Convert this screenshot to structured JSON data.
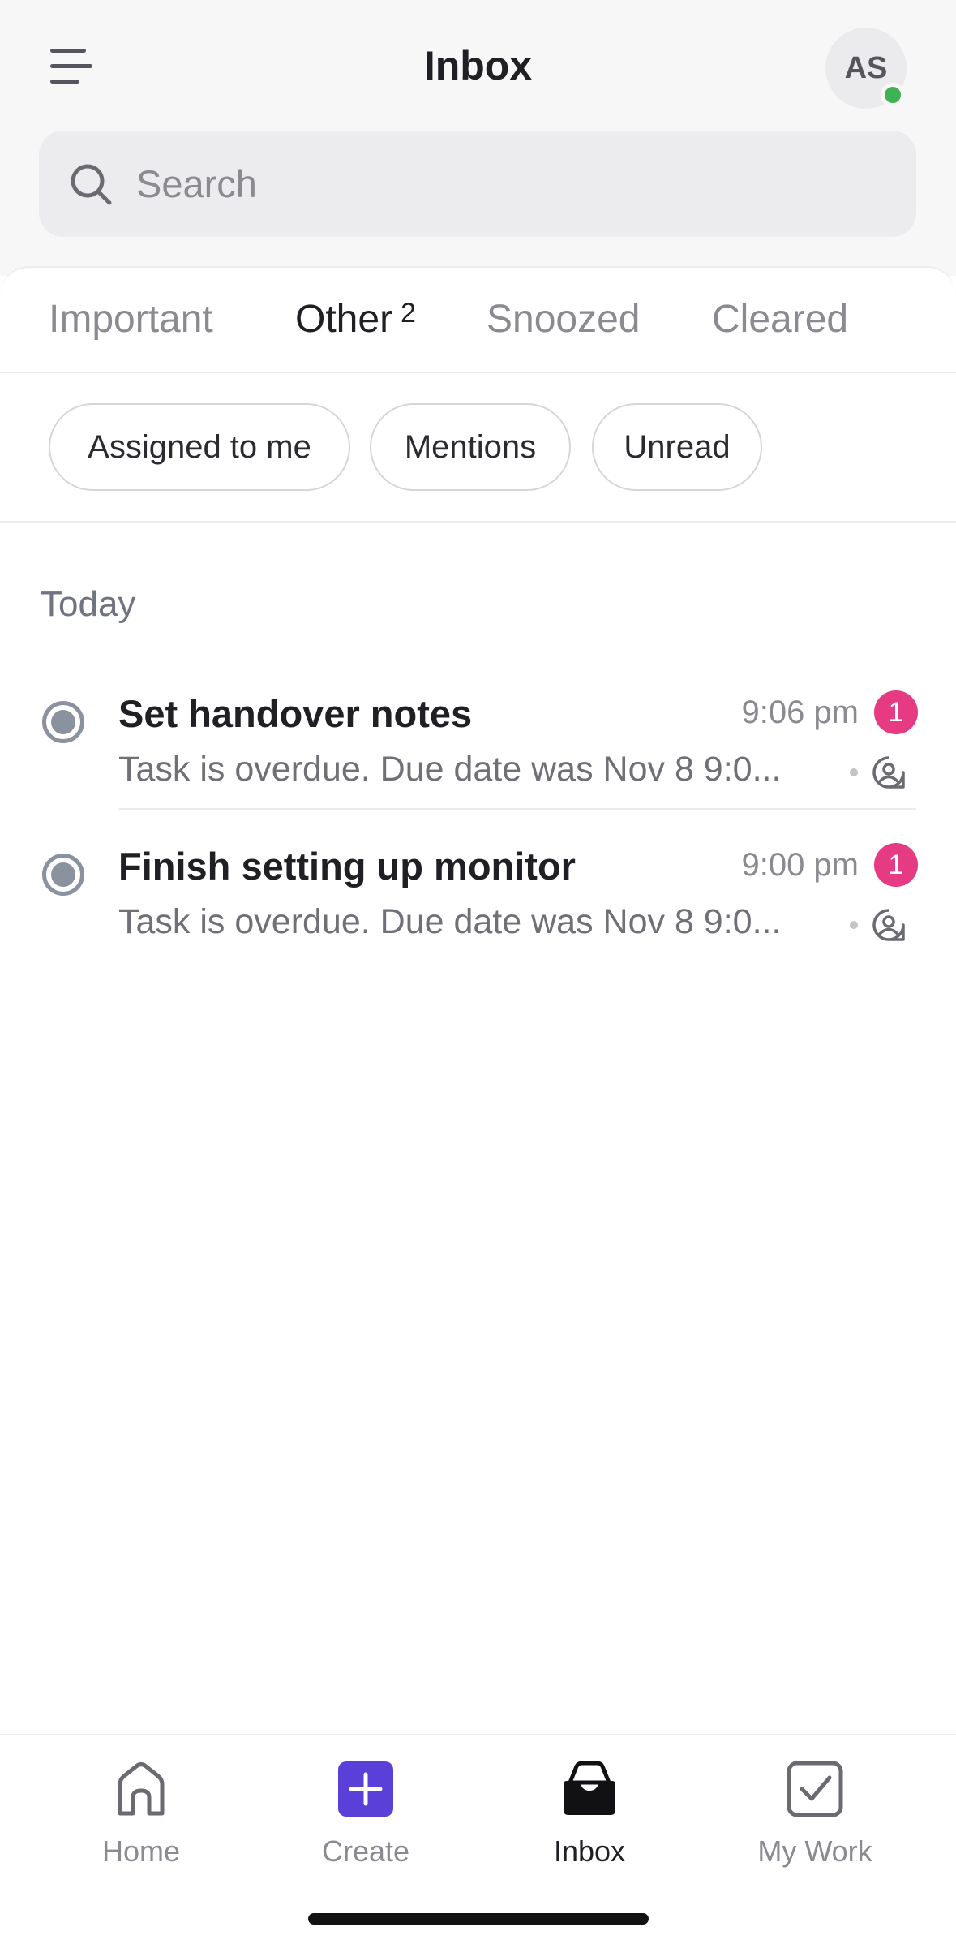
{
  "header": {
    "title": "Inbox",
    "avatar_initials": "AS"
  },
  "search": {
    "placeholder": "Search"
  },
  "tabs": [
    {
      "label": "Important"
    },
    {
      "label": "Other",
      "count": "2"
    },
    {
      "label": "Snoozed"
    },
    {
      "label": "Cleared"
    }
  ],
  "filters": [
    {
      "label": "Assigned to me"
    },
    {
      "label": "Mentions"
    },
    {
      "label": "Unread"
    }
  ],
  "section": {
    "label": "Today"
  },
  "items": [
    {
      "title": "Set handover notes",
      "time": "9:06 pm",
      "badge": "1",
      "subtitle": "Task is overdue. Due date was Nov 8 9:0..."
    },
    {
      "title": "Finish setting up monitor",
      "time": "9:00 pm",
      "badge": "1",
      "subtitle": "Task is overdue. Due date was Nov 8 9:0..."
    }
  ],
  "nav": [
    {
      "label": "Home",
      "icon": "home-icon"
    },
    {
      "label": "Create",
      "icon": "plus-icon"
    },
    {
      "label": "Inbox",
      "icon": "inbox-icon"
    },
    {
      "label": "My Work",
      "icon": "checkbox-icon"
    }
  ],
  "colors": {
    "accent": "#5b3fd9",
    "badge": "#e63a82",
    "online": "#3fb255"
  }
}
